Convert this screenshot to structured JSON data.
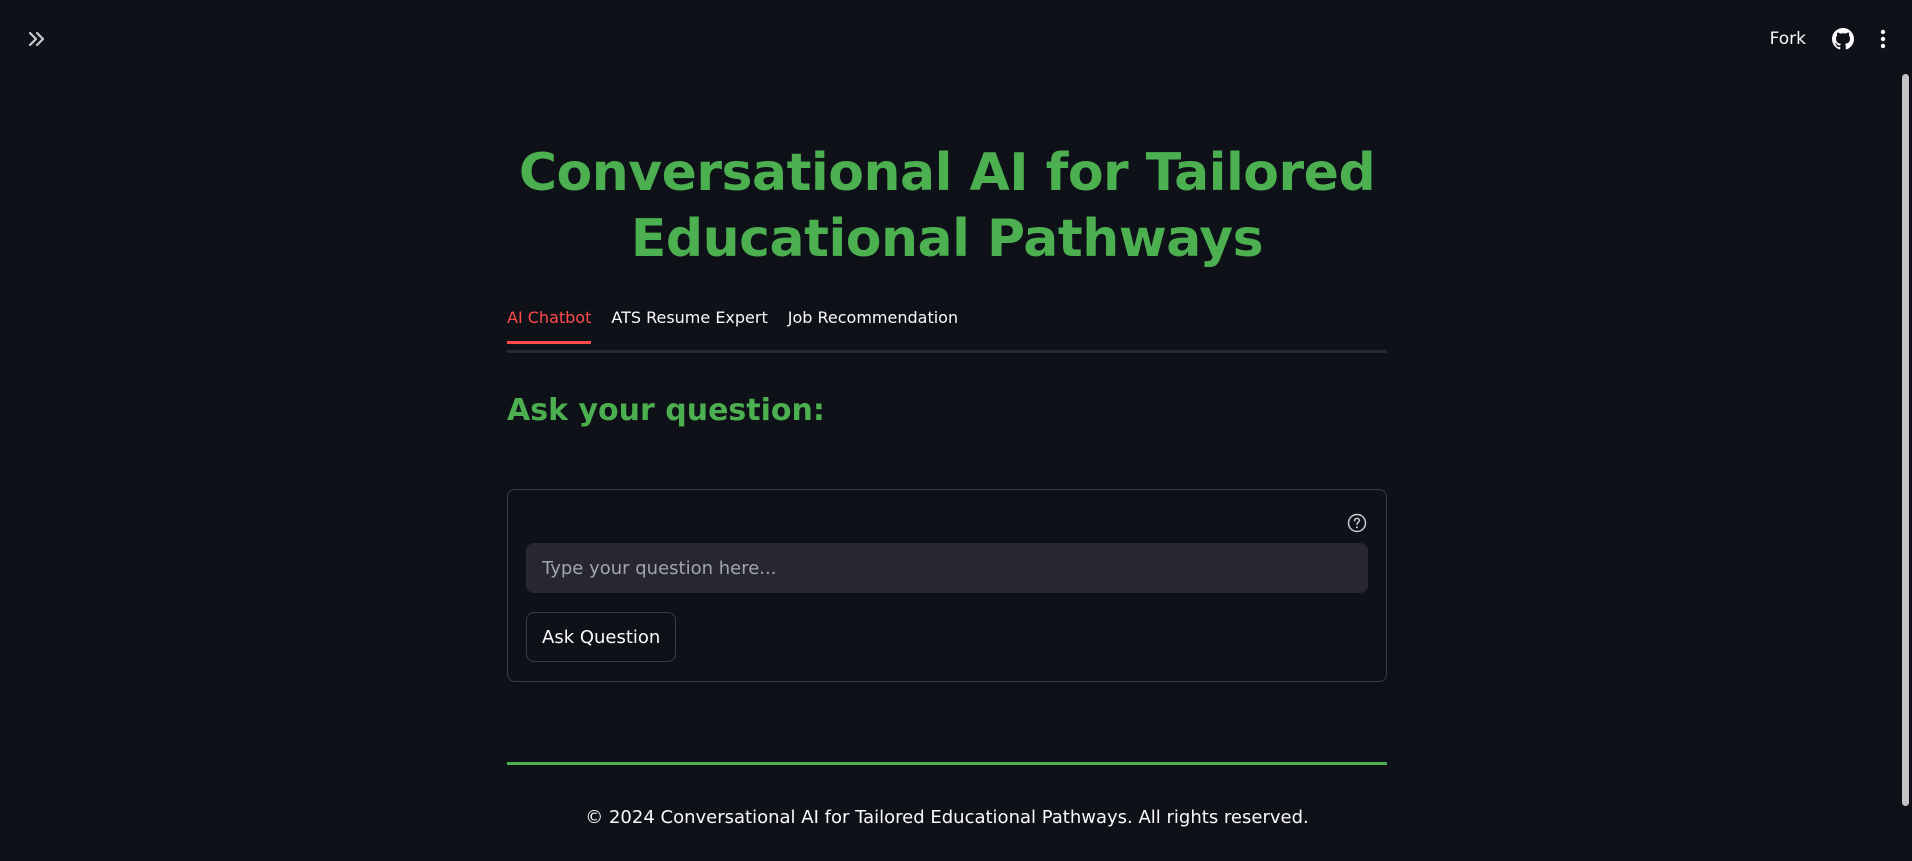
{
  "topbar": {
    "expand_icon": "chevron-double-right-icon",
    "fork_label": "Fork",
    "github_icon": "github-icon",
    "menu_icon": "kebab-menu-icon"
  },
  "main": {
    "title": "Conversational AI for Tailored Educational Pathways",
    "tabs": [
      {
        "label": "AI Chatbot",
        "active": true
      },
      {
        "label": "ATS Resume Expert",
        "active": false
      },
      {
        "label": "Job Recommendation",
        "active": false
      }
    ],
    "section_heading": "Ask your question:",
    "form": {
      "help_icon": "question-circle-icon",
      "input_placeholder": "Type your question here...",
      "input_value": "",
      "submit_label": "Ask Question"
    }
  },
  "footer": {
    "text": "© 2024 Conversational AI for Tailored Educational Pathways. All rights reserved."
  },
  "colors": {
    "background": "#0e1117",
    "accent_green": "#4caf50",
    "active_tab_red": "#ff4b4b",
    "input_bg": "#262730"
  }
}
